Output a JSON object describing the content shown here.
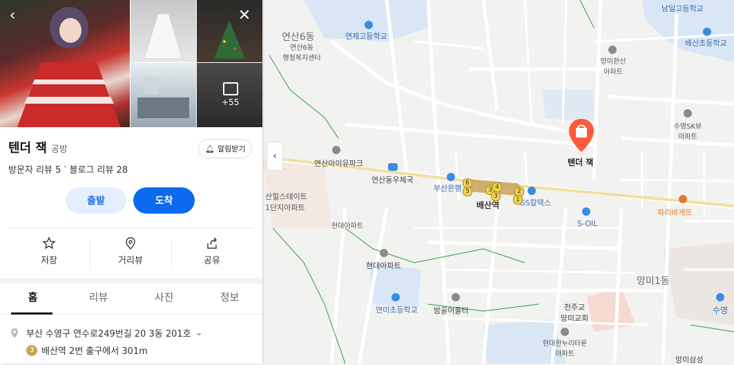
{
  "place": {
    "name": "텐더 잭",
    "category": "공방",
    "visitor_review": "방문자 리뷰 5",
    "separator": "·",
    "blog_review": "블로그 리뷰 28",
    "notify_label": "알림받기",
    "depart_label": "출발",
    "arrive_label": "도착",
    "photo_more": "+55"
  },
  "actions": [
    {
      "label": "저장",
      "icon": "star-icon"
    },
    {
      "label": "거리뷰",
      "icon": "location-pin-icon"
    },
    {
      "label": "공유",
      "icon": "share-icon"
    }
  ],
  "tabs": [
    "홈",
    "리뷰",
    "사진",
    "정보"
  ],
  "address": "부산 수영구 연수로249번길 20 3동 201호",
  "subway": {
    "line": "3",
    "text": "배산역 2번 출구에서 301m"
  },
  "map": {
    "labels": {
      "yeonsan6": "연산6동",
      "yeonsan6_center": "연산6동\n행정복지센터",
      "yeonje_hs": "연제고등학교",
      "namil_hs": "남일고등학교",
      "baesan_es": "배산초등학교",
      "mangmi_hansin": "망미한신\n아파트",
      "suyeong_sk": "수영SK뷰\n아파트",
      "yeonsan_park": "연산아이유파크",
      "post_office": "연산동우체국",
      "busan_bank": "부산은행",
      "baesan_station": "배산역",
      "gs_caltex": "GS칼텍스",
      "s_oil": "S-OIL",
      "paris": "파리바게뜨",
      "sanhill": "산힐스테이트\n1단지아파트",
      "hyundai1": "현대아파트",
      "hyundai2": "현대아파트",
      "mangmi1": "망미1동",
      "yeonmi_es": "연미초등학교",
      "bamgol": "밤골어울터",
      "cheonju": "천주교\n망미교회",
      "hyundai_hanuri": "현대한누리타운\n아파트",
      "suyeong": "수영",
      "mangmi_samsung": "망미삼성",
      "poi_name": "텐더 잭"
    },
    "exit_numbers": [
      "6",
      "5",
      "3",
      "4",
      "3",
      "2",
      "1"
    ]
  },
  "colors": {
    "accent": "#0b6af0",
    "poi": "#ff5a3c",
    "subway_line3": "#c9a55a"
  }
}
